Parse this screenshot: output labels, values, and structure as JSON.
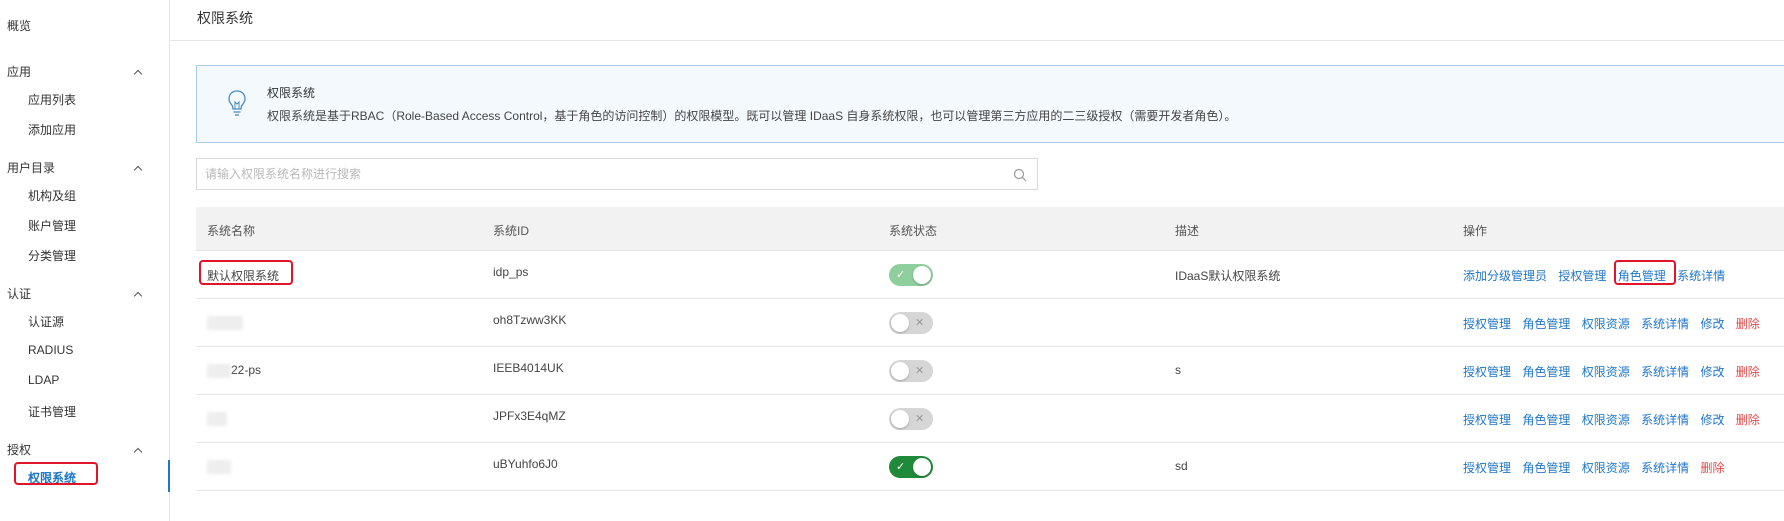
{
  "sidebar": {
    "overview": "概览",
    "groups": [
      {
        "label": "应用",
        "items": [
          "应用列表",
          "添加应用"
        ]
      },
      {
        "label": "用户目录",
        "items": [
          "机构及组",
          "账户管理",
          "分类管理"
        ]
      },
      {
        "label": "认证",
        "items": [
          "认证源",
          "RADIUS",
          "LDAP",
          "证书管理"
        ]
      },
      {
        "label": "授权",
        "items": [
          "权限系统"
        ]
      }
    ],
    "active_item": "权限系统"
  },
  "header": {
    "title": "权限系统"
  },
  "info": {
    "title": "权限系统",
    "description": "权限系统是基于RBAC（Role-Based Access Control，基于角色的访问控制）的权限模型。既可以管理 IDaaS 自身系统权限，也可以管理第三方应用的二三级授权（需要开发者角色）。"
  },
  "search": {
    "placeholder": "请输入权限系统名称进行搜索",
    "value": ""
  },
  "table": {
    "columns": [
      "系统名称",
      "系统ID",
      "系统状态",
      "描述",
      "操作"
    ],
    "rows": [
      {
        "name": "默认权限系统",
        "id": "idp_ps",
        "status": "on-soft",
        "desc": "IDaaS默认权限系统",
        "actions": [
          "添加分级管理员",
          "授权管理",
          "角色管理",
          "系统详情"
        ]
      },
      {
        "name": "",
        "id": "oh8Tzww3KK",
        "status": "off",
        "desc": "",
        "actions": [
          "授权管理",
          "角色管理",
          "权限资源",
          "系统详情",
          "修改",
          "删除"
        ]
      },
      {
        "name": "22-ps",
        "id": "IEEB4014UK",
        "status": "off",
        "desc": "s",
        "actions": [
          "授权管理",
          "角色管理",
          "权限资源",
          "系统详情",
          "修改",
          "删除"
        ]
      },
      {
        "name": "",
        "id": "JPFx3E4qMZ",
        "status": "off",
        "desc": "",
        "actions": [
          "授权管理",
          "角色管理",
          "权限资源",
          "系统详情",
          "修改",
          "删除"
        ]
      },
      {
        "name": "",
        "id": "uBYuhfo6J0",
        "status": "on-strong",
        "desc": "sd",
        "actions": [
          "授权管理",
          "角色管理",
          "权限资源",
          "系统详情",
          "删除"
        ]
      }
    ]
  },
  "colors": {
    "link": "#1f77c7",
    "danger": "#e04a4a",
    "highlight": "#e0142a",
    "toggle_on": "#1f8a3a"
  }
}
